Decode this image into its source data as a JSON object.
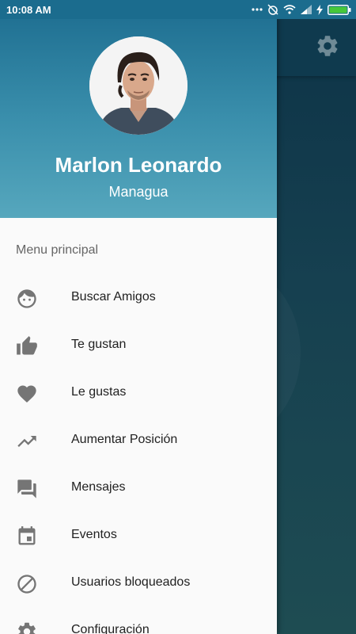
{
  "status_bar": {
    "time": "10:08 AM"
  },
  "background_app": {
    "toolbar_icon": "gear-icon"
  },
  "drawer": {
    "profile": {
      "name": "Marlon Leonardo",
      "city": "Managua"
    },
    "section_title": "Menu principal",
    "items": [
      {
        "label": "Buscar Amigos",
        "icon": "face-icon"
      },
      {
        "label": "Te gustan",
        "icon": "thumb-up-icon"
      },
      {
        "label": "Le gustas",
        "icon": "heart-icon"
      },
      {
        "label": "Aumentar Posición",
        "icon": "trending-up-icon"
      },
      {
        "label": "Mensajes",
        "icon": "forum-icon"
      },
      {
        "label": "Eventos",
        "icon": "calendar-icon"
      },
      {
        "label": "Usuarios bloqueados",
        "icon": "block-icon"
      },
      {
        "label": "Configuración",
        "icon": "gear-icon"
      }
    ]
  },
  "colors": {
    "header_top": "#1c6c8f",
    "header_bottom": "#56a7bd",
    "icon_gray": "#757575"
  }
}
